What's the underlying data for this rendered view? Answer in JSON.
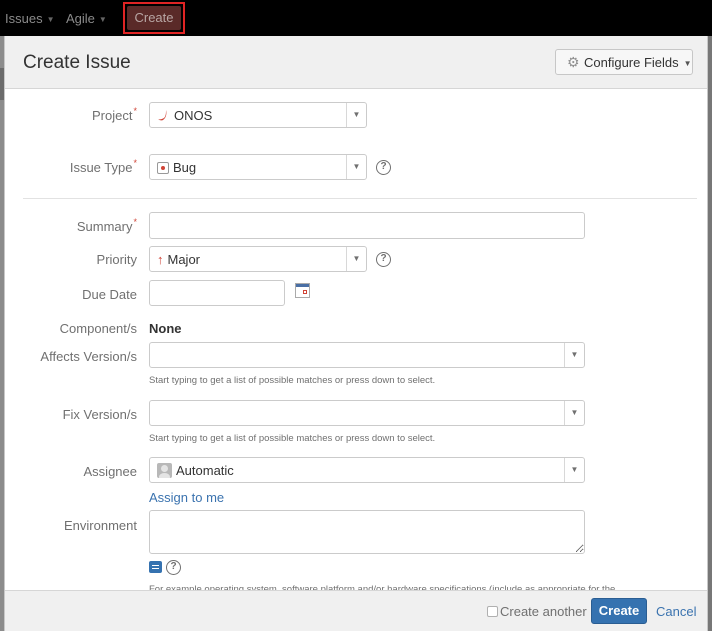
{
  "topnav": {
    "items": [
      {
        "label": "Issues",
        "icon": "chevron-down-icon"
      },
      {
        "label": "Agile",
        "icon": "chevron-down-icon"
      }
    ],
    "create_label": "Create",
    "caret": "▼"
  },
  "dialog": {
    "title": "Create Issue",
    "configure_fields": {
      "label": "Configure Fields",
      "icon": "gear-icon",
      "glyph": "⚙",
      "caret": "▼"
    }
  },
  "form": {
    "project": {
      "label": "Project",
      "required": "*",
      "value": "ONOS",
      "icon": "onos-logo-icon",
      "icon_color": "#d04437",
      "arrow": "▼"
    },
    "issue_type": {
      "label": "Issue Type",
      "required": "*",
      "value": "Bug",
      "icon": "bug-icon",
      "icon_color": "#d04437",
      "arrow": "▼",
      "help": "?"
    },
    "summary": {
      "label": "Summary",
      "required": "*",
      "value": ""
    },
    "priority": {
      "label": "Priority",
      "value": "Major",
      "icon": "arrow-up-icon",
      "icon_glyph": "↑",
      "icon_color": "#d04437",
      "arrow": "▼",
      "help": "?"
    },
    "due_date": {
      "label": "Due Date",
      "value": "",
      "icon": "calendar-icon"
    },
    "components": {
      "label": "Component/s",
      "value": "None"
    },
    "affects_version": {
      "label": "Affects Version/s",
      "value": "",
      "arrow": "▼",
      "hint": "Start typing to get a list of possible matches or press down to select."
    },
    "fix_version": {
      "label": "Fix Version/s",
      "value": "",
      "arrow": "▼",
      "hint": "Start typing to get a list of possible matches or press down to select."
    },
    "assignee": {
      "label": "Assignee",
      "value": "Automatic",
      "icon": "avatar-icon",
      "arrow": "▼",
      "assign_to_me": "Assign to me"
    },
    "environment": {
      "label": "Environment",
      "value": "",
      "help": "?",
      "hint": "For example operating system, software platform and/or hardware specifications (include as appropriate for the"
    }
  },
  "footer": {
    "create_another": "Create another",
    "create_another_checked": false,
    "create": "Create",
    "cancel": "Cancel"
  },
  "colors": {
    "primary": "#3572b0",
    "link": "#3b73af",
    "required": "#d04437",
    "highlight_border": "#e02424"
  }
}
